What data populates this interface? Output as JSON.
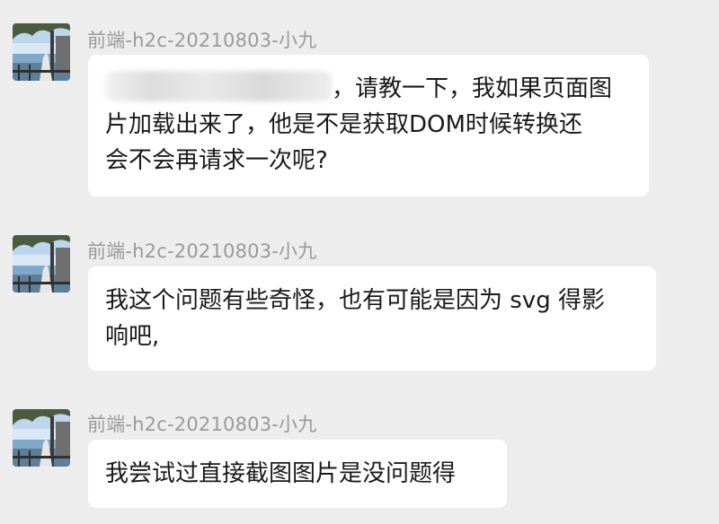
{
  "messages": [
    {
      "sender": "前端-h2c-20210803-小九",
      "mention_hidden": true,
      "lines": [
        "，请教一下，我如果页面图",
        "片加载出来了，他是不是获取DOM时候转换还",
        "会不会再请求一次呢?"
      ]
    },
    {
      "sender": "前端-h2c-20210803-小九",
      "lines": [
        "我这个问题有些奇怪，也有可能是因为 svg 得影",
        "响吧,"
      ]
    },
    {
      "sender": "前端-h2c-20210803-小九",
      "lines": [
        "我尝试过直接截图图片是没问题得"
      ]
    }
  ],
  "colors": {
    "background": "#ededed",
    "bubble": "#ffffff",
    "sender_text": "#9a9a9a",
    "message_text": "#1a1a1a"
  },
  "icons": {
    "avatar": "avatar-photo-boardwalk-lake"
  }
}
